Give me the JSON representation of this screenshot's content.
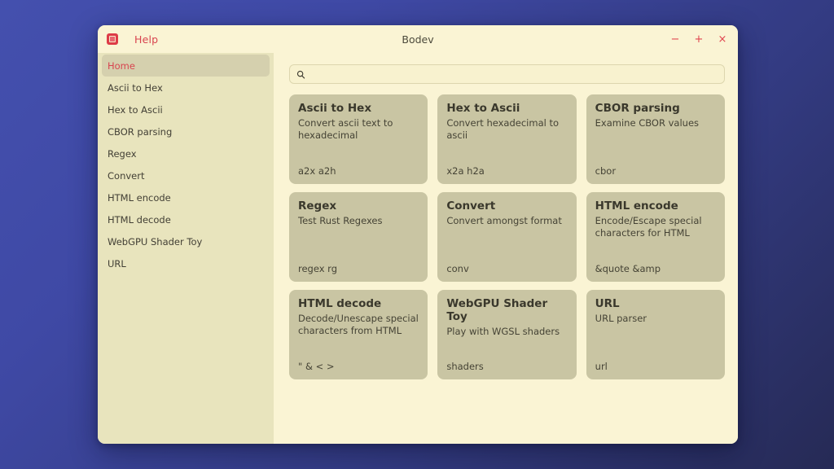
{
  "desktop": {
    "background_top_color": "#4450ae",
    "background_bottom_color": "#262a55"
  },
  "window": {
    "title": "Bodev",
    "app_icon": "app-logo-icon",
    "menu": [
      {
        "label": "Help",
        "name": "menu-help"
      }
    ],
    "controls": {
      "minimize": "−",
      "maximize": "+",
      "close": "×",
      "color": "#e0444f"
    }
  },
  "sidebar": {
    "background": "#e8e4bd",
    "active_background": "#d5d0ae",
    "active_color": "#d8444f",
    "items": [
      {
        "label": "Home",
        "active": true
      },
      {
        "label": "Ascii to Hex",
        "active": false
      },
      {
        "label": "Hex to Ascii",
        "active": false
      },
      {
        "label": "CBOR parsing",
        "active": false
      },
      {
        "label": "Regex",
        "active": false
      },
      {
        "label": "Convert",
        "active": false
      },
      {
        "label": "HTML encode",
        "active": false
      },
      {
        "label": "HTML decode",
        "active": false
      },
      {
        "label": "WebGPU Shader Toy",
        "active": false
      },
      {
        "label": "URL",
        "active": false
      }
    ]
  },
  "search": {
    "icon": "search-icon",
    "value": "",
    "placeholder": ""
  },
  "cards": [
    {
      "title": "Ascii to Hex",
      "description": "Convert ascii text to hexadecimal",
      "tags": "a2x a2h"
    },
    {
      "title": "Hex to Ascii",
      "description": "Convert hexadecimal to ascii",
      "tags": "x2a h2a"
    },
    {
      "title": "CBOR parsing",
      "description": "Examine CBOR values",
      "tags": "cbor"
    },
    {
      "title": "Regex",
      "description": "Test Rust Regexes",
      "tags": "regex rg"
    },
    {
      "title": "Convert",
      "description": "Convert amongst format",
      "tags": "conv"
    },
    {
      "title": "HTML encode",
      "description": "Encode/Escape special characters for HTML",
      "tags": "&quote &amp"
    },
    {
      "title": "HTML decode",
      "description": "Decode/Unescape special characters from HTML",
      "tags": "\" & < >"
    },
    {
      "title": "WebGPU Shader Toy",
      "description": "Play with WGSL shaders",
      "tags": "shaders"
    },
    {
      "title": "URL",
      "description": "URL parser",
      "tags": "url"
    }
  ]
}
